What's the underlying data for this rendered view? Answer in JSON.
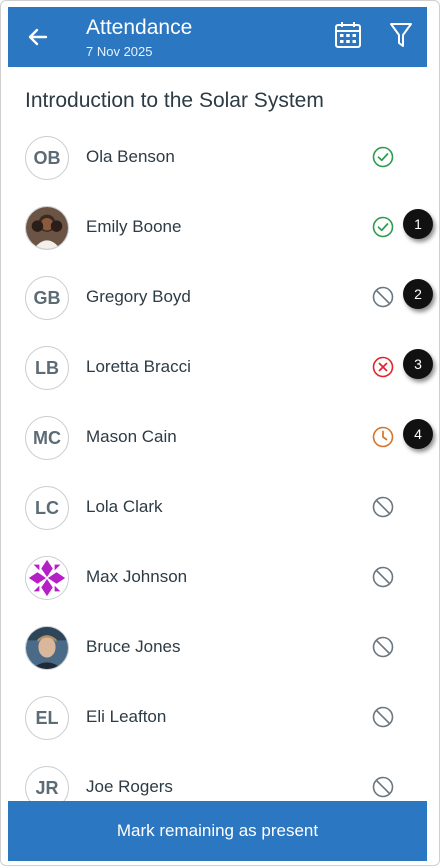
{
  "header": {
    "title": "Attendance",
    "date": "7 Nov 2025"
  },
  "course_title": "Introduction to the Solar System",
  "students": [
    {
      "initials": "OB",
      "name": "Ola Benson",
      "status": "present",
      "badge": ""
    },
    {
      "initials": "",
      "name": "Emily Boone",
      "status": "present",
      "badge": "1"
    },
    {
      "initials": "GB",
      "name": "Gregory Boyd",
      "status": "unmarked",
      "badge": "2"
    },
    {
      "initials": "LB",
      "name": "Loretta Bracci",
      "status": "absent",
      "badge": "3"
    },
    {
      "initials": "MC",
      "name": "Mason Cain",
      "status": "late",
      "badge": "4"
    },
    {
      "initials": "LC",
      "name": "Lola Clark",
      "status": "unmarked",
      "badge": ""
    },
    {
      "initials": "",
      "name": "Max Johnson",
      "status": "unmarked",
      "badge": ""
    },
    {
      "initials": "",
      "name": "Bruce Jones",
      "status": "unmarked",
      "badge": ""
    },
    {
      "initials": "EL",
      "name": "Eli Leafton",
      "status": "unmarked",
      "badge": ""
    },
    {
      "initials": "JR",
      "name": "Joe Rogers",
      "status": "unmarked",
      "badge": ""
    }
  ],
  "footer": {
    "button_label": "Mark remaining as present"
  },
  "colors": {
    "brand": "#2b77c1",
    "present": "#2e9a4e",
    "absent": "#e0252d",
    "late": "#d7742a",
    "unmarked": "#6b7780"
  }
}
